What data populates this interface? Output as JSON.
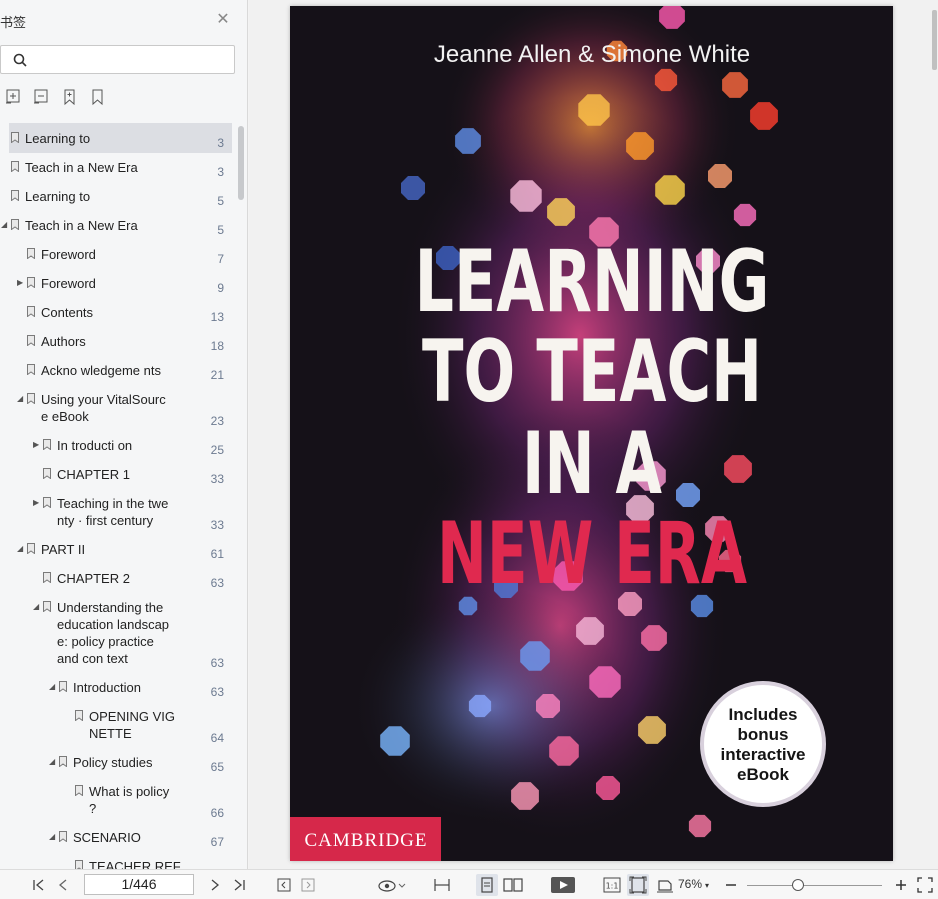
{
  "sidebar": {
    "title": "书签",
    "search": {
      "value": "",
      "placeholder": ""
    },
    "tools": [
      "expand-all-icon",
      "collapse-all-icon",
      "add-bookmark-icon",
      "bookmark-icon"
    ],
    "items": [
      {
        "label": "Learning to",
        "page": "3",
        "level": 0,
        "arrow": "",
        "selected": true
      },
      {
        "label": "Teach in a New Era",
        "page": "3",
        "level": 0,
        "arrow": ""
      },
      {
        "label": "Learning to",
        "page": "5",
        "level": 0,
        "arrow": ""
      },
      {
        "label": "Teach in a New Era",
        "page": "5",
        "level": 0,
        "arrow": "down"
      },
      {
        "label": "Foreword",
        "page": "7",
        "level": 1,
        "arrow": ""
      },
      {
        "label": "Foreword",
        "page": "9",
        "level": 1,
        "arrow": "right"
      },
      {
        "label": "Contents",
        "page": "13",
        "level": 1,
        "arrow": ""
      },
      {
        "label": "Authors",
        "page": "18",
        "level": 1,
        "arrow": ""
      },
      {
        "label": "Ackno wledgeme nts",
        "page": "21",
        "level": 1,
        "arrow": ""
      },
      {
        "label": "Using your VitalSourc\ne eBook",
        "page": "23",
        "level": 1,
        "arrow": "down"
      },
      {
        "label": "In troducti on",
        "page": "25",
        "level": 2,
        "arrow": "right"
      },
      {
        "label": "CHAPTER 1",
        "page": "33",
        "level": 2,
        "arrow": ""
      },
      {
        "label": "Teaching in the twe\nnty · first century",
        "page": "33",
        "level": 2,
        "arrow": "right"
      },
      {
        "label": "PART II",
        "page": "61",
        "level": 1,
        "arrow": "down"
      },
      {
        "label": "CHAPTER 2",
        "page": "63",
        "level": 2,
        "arrow": ""
      },
      {
        "label": "Understanding the\neducation landscap\ne:   policy practice\nand con text",
        "page": "63",
        "level": 2,
        "arrow": "down"
      },
      {
        "label": "Introduction",
        "page": "63",
        "level": 3,
        "arrow": "down"
      },
      {
        "label": "OPENING VIG\nNETTE",
        "page": "64",
        "level": 4,
        "arrow": ""
      },
      {
        "label": "Policy studies",
        "page": "65",
        "level": 3,
        "arrow": "down"
      },
      {
        "label": "What is policy\n?",
        "page": "66",
        "level": 4,
        "arrow": ""
      },
      {
        "label": "SCENARIO",
        "page": "67",
        "level": 3,
        "arrow": "down"
      },
      {
        "label": "TEACHER REF",
        "page": "",
        "level": 4,
        "arrow": ""
      }
    ]
  },
  "cover": {
    "authors": "Jeanne Allen & Simone White",
    "title_lines": [
      "LEARNING",
      "TO TEACH",
      "IN A"
    ],
    "title_accent": "NEW ERA",
    "badge_lines": [
      "Includes",
      "bonus",
      "interactive",
      "eBook"
    ],
    "publisher": "CAMBRIDGE",
    "colors": {
      "background": "#151118",
      "accent": "#e0294f",
      "publisher_bg": "#d6284a",
      "title": "#f7f4ef"
    }
  },
  "toolbar": {
    "page_value": "1/446",
    "zoom": "76%",
    "zoom_fraction": 0.38,
    "icons": [
      "first-page-icon",
      "prev-page-icon",
      "next-page-icon",
      "last-page-icon",
      "back-icon",
      "forward-icon",
      "read-mode-icon",
      "fit-width-icon",
      "single-page-icon",
      "two-page-icon",
      "play-icon",
      "actual-size-icon",
      "fit-page-icon",
      "rotate-icon",
      "zoom-out-icon",
      "zoom-in-icon",
      "fullscreen-icon"
    ]
  }
}
